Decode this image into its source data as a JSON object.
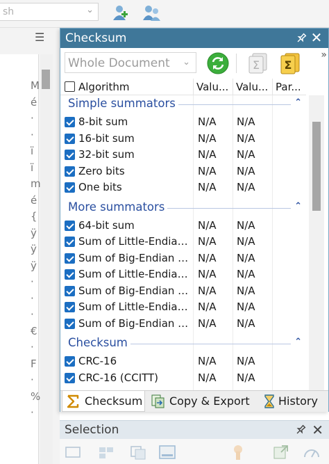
{
  "background": {
    "combo_value": "sh",
    "toolbar_icons": [
      "add-user-icon",
      "users-icon"
    ],
    "side_glyphs": [
      "M",
      "é",
      "·",
      "·",
      "ï",
      "ï",
      "m",
      "é",
      "{",
      "ÿ",
      "ÿ",
      "ÿ",
      "·",
      "·",
      "·",
      "€",
      "·",
      "F",
      "·",
      "%",
      "·"
    ]
  },
  "checksum_panel": {
    "title": "Checksum",
    "scope": "Whole Document",
    "toolbar": [
      "calculate-icon",
      "sum-selection-icon",
      "sum-document-icon"
    ],
    "columns": {
      "algorithm": "Algorithm",
      "value1": "Valu...",
      "value2": "Valu...",
      "params": "Par..."
    },
    "groups": [
      {
        "name": "Simple summators",
        "items": [
          {
            "name": "8-bit sum",
            "v1": "N/A",
            "v2": "N/A"
          },
          {
            "name": "16-bit sum",
            "v1": "N/A",
            "v2": "N/A"
          },
          {
            "name": "32-bit sum",
            "v1": "N/A",
            "v2": "N/A"
          },
          {
            "name": "Zero bits",
            "v1": "N/A",
            "v2": "N/A"
          },
          {
            "name": "One bits",
            "v1": "N/A",
            "v2": "N/A"
          }
        ]
      },
      {
        "name": "More summators",
        "items": [
          {
            "name": "64-bit sum",
            "v1": "N/A",
            "v2": "N/A"
          },
          {
            "name": "Sum of Little-Endian...",
            "v1": "N/A",
            "v2": "N/A"
          },
          {
            "name": "Sum of Big-Endian 1...",
            "v1": "N/A",
            "v2": "N/A"
          },
          {
            "name": "Sum of Little-Endian...",
            "v1": "N/A",
            "v2": "N/A"
          },
          {
            "name": "Sum of Big-Endian 3...",
            "v1": "N/A",
            "v2": "N/A"
          },
          {
            "name": "Sum of Little-Endian...",
            "v1": "N/A",
            "v2": "N/A"
          },
          {
            "name": "Sum of Big-Endian 6...",
            "v1": "N/A",
            "v2": "N/A"
          }
        ]
      },
      {
        "name": "Checksum",
        "items": [
          {
            "name": "CRC-16",
            "v1": "N/A",
            "v2": "N/A"
          },
          {
            "name": "CRC-16 (CCITT)",
            "v1": "N/A",
            "v2": "N/A"
          }
        ]
      }
    ],
    "tabs": [
      {
        "label": "Checksum",
        "icon": "sigma-icon",
        "active": true
      },
      {
        "label": "Copy & Export",
        "icon": "copy-export-icon",
        "active": false
      },
      {
        "label": "History",
        "icon": "hourglass-icon",
        "active": false
      }
    ]
  },
  "selection_panel": {
    "title": "Selection"
  },
  "colors": {
    "title_bar": "#3f7799",
    "checkbox": "#1b6ec2",
    "group_text": "#2a4fa0"
  }
}
